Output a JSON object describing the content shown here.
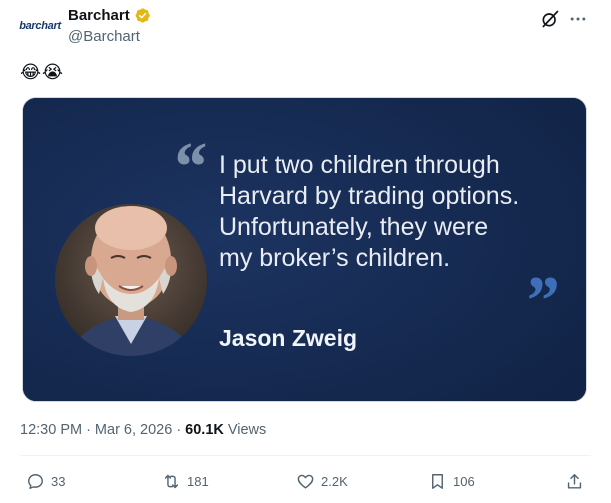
{
  "author": {
    "logo_text": "barchart",
    "display_name": "Barchart",
    "handle": "@Barchart"
  },
  "post": {
    "emojis": "😂😭",
    "media": {
      "quote_text": "I put two children through\nHarvard by trading options.\nUnfortunately, they were\nmy broker’s children.",
      "quote_author": "Jason Zweig"
    }
  },
  "meta": {
    "time": "12:30 PM",
    "date": "Mar 6, 2026",
    "separator": "·",
    "views_count": "60.1K",
    "views_label": "Views"
  },
  "actions": {
    "replies": "33",
    "reposts": "181",
    "likes": "2.2K",
    "bookmarks": "106"
  },
  "icons": [
    "verified-badge-icon",
    "grok-icon",
    "more-icon",
    "reply-icon",
    "repost-icon",
    "like-icon",
    "bookmark-icon",
    "share-icon"
  ],
  "colors": {
    "verified": "#e2b719",
    "media_bg": "#15284d",
    "muted_text": "#536471"
  }
}
